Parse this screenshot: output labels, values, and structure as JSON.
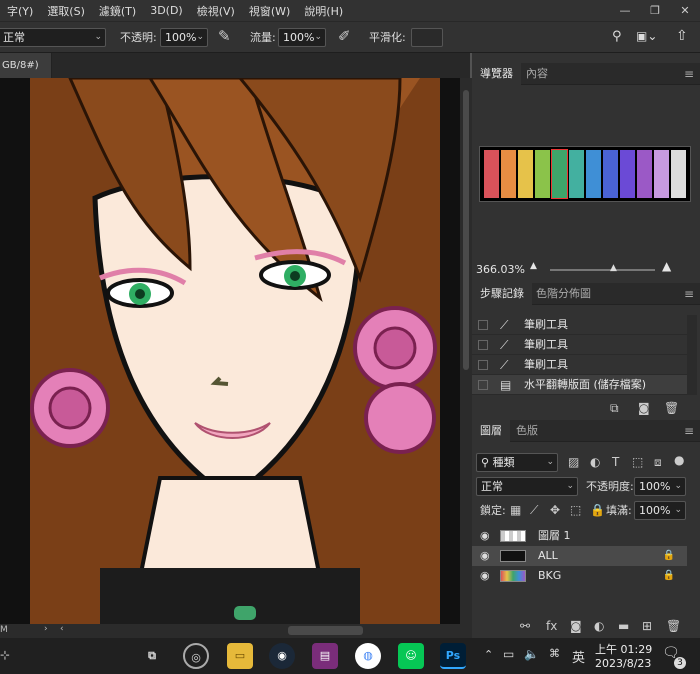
{
  "menubar": {
    "items": [
      "字(Y)",
      "選取(S)",
      "濾鏡(T)",
      "3D(D)",
      "檢視(V)",
      "視窗(W)",
      "說明(H)"
    ]
  },
  "options": {
    "mode_value": "正常",
    "opacity_label": "不透明:",
    "opacity_value": "100%",
    "flow_label": "流量:",
    "flow_value": "100%",
    "smoothing_label": "平滑化:",
    "smoothing_value": ""
  },
  "doc_tab": {
    "label": "GB/8#)",
    "close": "×"
  },
  "status": {
    "zoom": "M"
  },
  "navigator": {
    "tabs": [
      "導覽器",
      "內容"
    ],
    "zoom_value": "366.03%"
  },
  "history": {
    "tabs": [
      "步驟記錄",
      "色階分佈圖"
    ],
    "items": [
      "筆刷工具",
      "筆刷工具",
      "筆刷工具",
      "水平翻轉版面 (儲存檔案)"
    ]
  },
  "layers": {
    "tabs": [
      "圖層",
      "色版"
    ],
    "filter_value": "種類",
    "blend_value": "正常",
    "opacity_label": "不透明度:",
    "opacity_value": "100%",
    "lock_label": "鎖定:",
    "fill_label": "填滿:",
    "fill_value": "100%",
    "rows": [
      {
        "name": "圖層 1"
      },
      {
        "name": "ALL"
      },
      {
        "name": "BKG"
      }
    ]
  },
  "taskbar": {
    "ime": "英",
    "time": "上午 01:29",
    "date": "2023/8/23",
    "notifications": "3",
    "ps_label": "Ps"
  },
  "colors": {
    "accent_green": "#3fa46a",
    "hair_brown": "#8a4a1c",
    "skin": "#fbe9da",
    "rose": "#e480b8"
  }
}
